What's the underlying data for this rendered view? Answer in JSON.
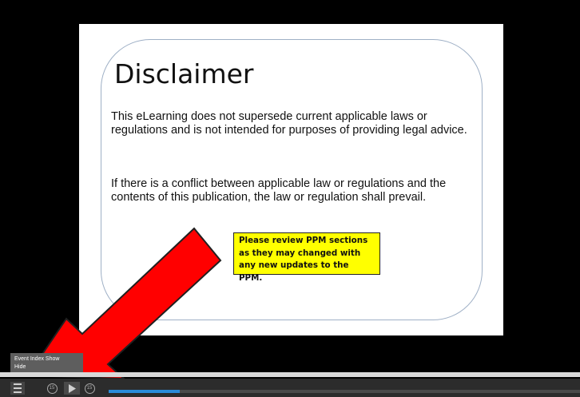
{
  "slide": {
    "title": "Disclaimer",
    "paragraph1": "This eLearning does not supersede current applicable laws or regulations and is not intended for purposes of providing legal advice.",
    "paragraph2": "If there is a conflict between applicable law or regulations and the contents of this publication, the law or regulation shall prevail.",
    "note": "Please review PPM sections as they may changed with any new updates to the PPM."
  },
  "tooltip": {
    "line1": "Event Index Show",
    "line2": "Hide"
  },
  "controls": {
    "menu_icon": "hamburger-menu-icon",
    "skip_back_icon": "rewind-15-icon",
    "skip_back_label": "15",
    "play_icon": "play-icon",
    "skip_forward_icon": "forward-15-icon",
    "skip_forward_label": "15",
    "seek_progress_fraction": 0.15
  },
  "colors": {
    "arrow": "#ff0000",
    "note_background": "#ffff00",
    "seek_fill": "#2a8bd8"
  }
}
